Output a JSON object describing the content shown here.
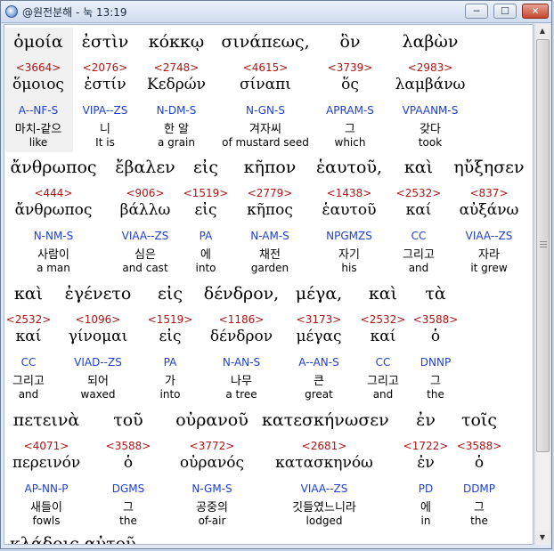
{
  "window": {
    "title": "@원전분해 - 눅 13:19",
    "minimize_glyph": "─",
    "maximize_glyph": "☐",
    "close_glyph": "✕"
  },
  "scrollbar": {
    "up_glyph": "▲",
    "down_glyph": "▼"
  },
  "rows": [
    {
      "words": [
        {
          "greek": "ὁμοία",
          "strong": "<3664>",
          "lexeme": "ὅμοιος",
          "parse": "A--NF-S",
          "korean": "마치-같으",
          "english": "like"
        },
        {
          "greek": "ἐστὶν",
          "strong": "<2076>",
          "lexeme": "ἐστίν",
          "parse": "VIPA--ZS",
          "korean": "니",
          "english": "It is"
        },
        {
          "greek": "κόκκῳ",
          "strong": "<2748>",
          "lexeme": "Κεδρών",
          "parse": "N-DM-S",
          "korean": "한 알",
          "english": "a grain"
        },
        {
          "greek": "σινάπεως,",
          "strong": "<4615>",
          "lexeme": "σίναπι",
          "parse": "N-GN-S",
          "korean": "겨자씨",
          "english": "of mustard seed"
        },
        {
          "greek": "ὃν",
          "strong": "<3739>",
          "lexeme": "ὅς",
          "parse": "APRAM-S",
          "korean": "그",
          "english": "which"
        },
        {
          "greek": "λαβὼν",
          "strong": "<2983>",
          "lexeme": "λαμβάνω",
          "parse": "VPAANM-S",
          "korean": "갖다",
          "english": "took"
        }
      ]
    },
    {
      "words": [
        {
          "greek": "ἄνθρωπος",
          "strong": "<444>",
          "lexeme": "ἄνθρωπος",
          "parse": "N-NM-S",
          "korean": "사람이",
          "english": "a man"
        },
        {
          "greek": "ἔβαλεν",
          "strong": "<906>",
          "lexeme": "βάλλω",
          "parse": "VIAA--ZS",
          "korean": "심은",
          "english": "and cast"
        },
        {
          "greek": "εἰς",
          "strong": "<1519>",
          "lexeme": "εἰς",
          "parse": "PA",
          "korean": "에",
          "english": "into"
        },
        {
          "greek": "κῆπον",
          "strong": "<2779>",
          "lexeme": "κῆπος",
          "parse": "N-AM-S",
          "korean": "채전",
          "english": "garden"
        },
        {
          "greek": "ἑαυτοῦ,",
          "strong": "<1438>",
          "lexeme": "ἑαυτοῦ",
          "parse": "NPGMZS",
          "korean": "자기",
          "english": "his"
        },
        {
          "greek": "καὶ",
          "strong": "<2532>",
          "lexeme": "καί",
          "parse": "CC",
          "korean": "그리고",
          "english": "and"
        },
        {
          "greek": "ηὔξησεν",
          "strong": "<837>",
          "lexeme": "αὐξάνω",
          "parse": "VIAA--ZS",
          "korean": "자라",
          "english": "it grew"
        }
      ]
    },
    {
      "words": [
        {
          "greek": "καὶ",
          "strong": "<2532>",
          "lexeme": "καί",
          "parse": "CC",
          "korean": "그리고",
          "english": "and"
        },
        {
          "greek": "ἐγένετο",
          "strong": "<1096>",
          "lexeme": "γίνομαι",
          "parse": "VIAD--ZS",
          "korean": "되어",
          "english": "waxed"
        },
        {
          "greek": "εἰς",
          "strong": "<1519>",
          "lexeme": "εἰς",
          "parse": "PA",
          "korean": "가",
          "english": "into"
        },
        {
          "greek": "δένδρον,",
          "strong": "<1186>",
          "lexeme": "δένδρον",
          "parse": "N-AN-S",
          "korean": "나무",
          "english": "a tree"
        },
        {
          "greek": "μέγα,",
          "strong": "<3173>",
          "lexeme": "μέγας",
          "parse": "A--AN-S",
          "korean": "큰",
          "english": "great"
        },
        {
          "greek": "καὶ",
          "strong": "<2532>",
          "lexeme": "καί",
          "parse": "CC",
          "korean": "그리고",
          "english": "and"
        },
        {
          "greek": "τὰ",
          "strong": "<3588>",
          "lexeme": "ὁ",
          "parse": "DNNP",
          "korean": "그",
          "english": "the"
        }
      ]
    },
    {
      "words": [
        {
          "greek": "πετεινὰ",
          "strong": "<4071>",
          "lexeme": "περεινόν",
          "parse": "AP-NN-P",
          "korean": "새들이",
          "english": "fowls"
        },
        {
          "greek": "τοῦ",
          "strong": "<3588>",
          "lexeme": "ὁ",
          "parse": "DGMS",
          "korean": "그",
          "english": "the"
        },
        {
          "greek": "οὐρανοῦ",
          "strong": "<3772>",
          "lexeme": "οὐρανός",
          "parse": "N-GM-S",
          "korean": "공중의",
          "english": "of-air"
        },
        {
          "greek": "κατεσκήνωσεν",
          "strong": "<2681>",
          "lexeme": "κατασκηνόω",
          "parse": "VIAA--ZS",
          "korean": "깃들였느니라",
          "english": "lodged"
        },
        {
          "greek": "ἐν",
          "strong": "<1722>",
          "lexeme": "ἐν",
          "parse": "PD",
          "korean": "에",
          "english": "in"
        },
        {
          "greek": "τοῖς",
          "strong": "<3588>",
          "lexeme": "ὁ",
          "parse": "DDMP",
          "korean": "그",
          "english": "the"
        }
      ]
    }
  ],
  "cutoff_text": "κλάδοις αὐτοῦ"
}
